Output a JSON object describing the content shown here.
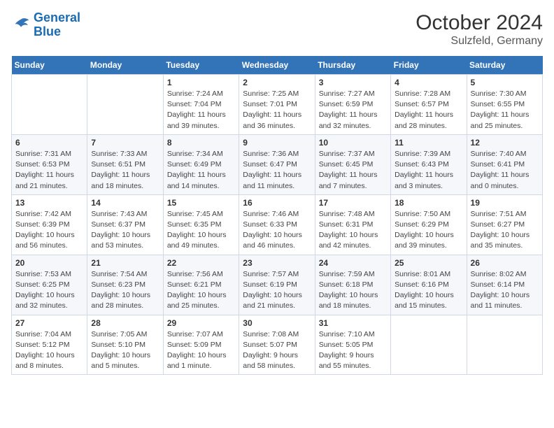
{
  "logo": {
    "line1": "General",
    "line2": "Blue"
  },
  "title": "October 2024",
  "subtitle": "Sulzfeld, Germany",
  "header_row": [
    "Sunday",
    "Monday",
    "Tuesday",
    "Wednesday",
    "Thursday",
    "Friday",
    "Saturday"
  ],
  "weeks": [
    [
      {
        "day": "",
        "info": ""
      },
      {
        "day": "",
        "info": ""
      },
      {
        "day": "1",
        "info": "Sunrise: 7:24 AM\nSunset: 7:04 PM\nDaylight: 11 hours and 39 minutes."
      },
      {
        "day": "2",
        "info": "Sunrise: 7:25 AM\nSunset: 7:01 PM\nDaylight: 11 hours and 36 minutes."
      },
      {
        "day": "3",
        "info": "Sunrise: 7:27 AM\nSunset: 6:59 PM\nDaylight: 11 hours and 32 minutes."
      },
      {
        "day": "4",
        "info": "Sunrise: 7:28 AM\nSunset: 6:57 PM\nDaylight: 11 hours and 28 minutes."
      },
      {
        "day": "5",
        "info": "Sunrise: 7:30 AM\nSunset: 6:55 PM\nDaylight: 11 hours and 25 minutes."
      }
    ],
    [
      {
        "day": "6",
        "info": "Sunrise: 7:31 AM\nSunset: 6:53 PM\nDaylight: 11 hours and 21 minutes."
      },
      {
        "day": "7",
        "info": "Sunrise: 7:33 AM\nSunset: 6:51 PM\nDaylight: 11 hours and 18 minutes."
      },
      {
        "day": "8",
        "info": "Sunrise: 7:34 AM\nSunset: 6:49 PM\nDaylight: 11 hours and 14 minutes."
      },
      {
        "day": "9",
        "info": "Sunrise: 7:36 AM\nSunset: 6:47 PM\nDaylight: 11 hours and 11 minutes."
      },
      {
        "day": "10",
        "info": "Sunrise: 7:37 AM\nSunset: 6:45 PM\nDaylight: 11 hours and 7 minutes."
      },
      {
        "day": "11",
        "info": "Sunrise: 7:39 AM\nSunset: 6:43 PM\nDaylight: 11 hours and 3 minutes."
      },
      {
        "day": "12",
        "info": "Sunrise: 7:40 AM\nSunset: 6:41 PM\nDaylight: 11 hours and 0 minutes."
      }
    ],
    [
      {
        "day": "13",
        "info": "Sunrise: 7:42 AM\nSunset: 6:39 PM\nDaylight: 10 hours and 56 minutes."
      },
      {
        "day": "14",
        "info": "Sunrise: 7:43 AM\nSunset: 6:37 PM\nDaylight: 10 hours and 53 minutes."
      },
      {
        "day": "15",
        "info": "Sunrise: 7:45 AM\nSunset: 6:35 PM\nDaylight: 10 hours and 49 minutes."
      },
      {
        "day": "16",
        "info": "Sunrise: 7:46 AM\nSunset: 6:33 PM\nDaylight: 10 hours and 46 minutes."
      },
      {
        "day": "17",
        "info": "Sunrise: 7:48 AM\nSunset: 6:31 PM\nDaylight: 10 hours and 42 minutes."
      },
      {
        "day": "18",
        "info": "Sunrise: 7:50 AM\nSunset: 6:29 PM\nDaylight: 10 hours and 39 minutes."
      },
      {
        "day": "19",
        "info": "Sunrise: 7:51 AM\nSunset: 6:27 PM\nDaylight: 10 hours and 35 minutes."
      }
    ],
    [
      {
        "day": "20",
        "info": "Sunrise: 7:53 AM\nSunset: 6:25 PM\nDaylight: 10 hours and 32 minutes."
      },
      {
        "day": "21",
        "info": "Sunrise: 7:54 AM\nSunset: 6:23 PM\nDaylight: 10 hours and 28 minutes."
      },
      {
        "day": "22",
        "info": "Sunrise: 7:56 AM\nSunset: 6:21 PM\nDaylight: 10 hours and 25 minutes."
      },
      {
        "day": "23",
        "info": "Sunrise: 7:57 AM\nSunset: 6:19 PM\nDaylight: 10 hours and 21 minutes."
      },
      {
        "day": "24",
        "info": "Sunrise: 7:59 AM\nSunset: 6:18 PM\nDaylight: 10 hours and 18 minutes."
      },
      {
        "day": "25",
        "info": "Sunrise: 8:01 AM\nSunset: 6:16 PM\nDaylight: 10 hours and 15 minutes."
      },
      {
        "day": "26",
        "info": "Sunrise: 8:02 AM\nSunset: 6:14 PM\nDaylight: 10 hours and 11 minutes."
      }
    ],
    [
      {
        "day": "27",
        "info": "Sunrise: 7:04 AM\nSunset: 5:12 PM\nDaylight: 10 hours and 8 minutes."
      },
      {
        "day": "28",
        "info": "Sunrise: 7:05 AM\nSunset: 5:10 PM\nDaylight: 10 hours and 5 minutes."
      },
      {
        "day": "29",
        "info": "Sunrise: 7:07 AM\nSunset: 5:09 PM\nDaylight: 10 hours and 1 minute."
      },
      {
        "day": "30",
        "info": "Sunrise: 7:08 AM\nSunset: 5:07 PM\nDaylight: 9 hours and 58 minutes."
      },
      {
        "day": "31",
        "info": "Sunrise: 7:10 AM\nSunset: 5:05 PM\nDaylight: 9 hours and 55 minutes."
      },
      {
        "day": "",
        "info": ""
      },
      {
        "day": "",
        "info": ""
      }
    ]
  ]
}
